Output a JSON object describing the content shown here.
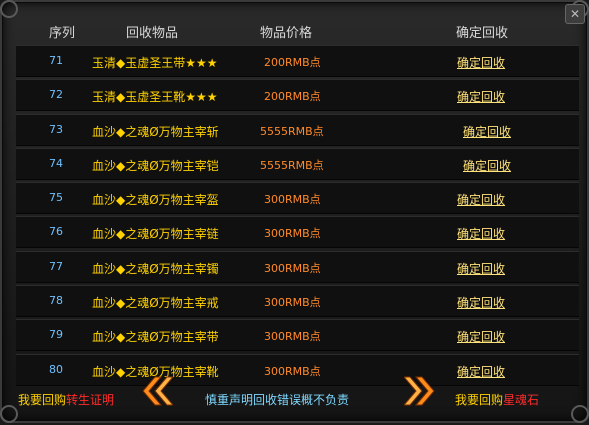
{
  "header": {
    "col_no": "序列",
    "col_item": "回收物品",
    "col_price": "物品价格",
    "col_action": "确定回收"
  },
  "rows": [
    {
      "no": "71",
      "item": "玉清◆玉虚圣王带★★★",
      "price": "200RMB点",
      "action": "确定回收"
    },
    {
      "no": "72",
      "item": "玉清◆玉虚圣王靴★★★",
      "price": "200RMB点",
      "action": "确定回收"
    },
    {
      "no": "73",
      "item": "血沙◆之魂Ø万物主宰斩",
      "price": "5555RMB点",
      "action": "确定回收"
    },
    {
      "no": "74",
      "item": "血沙◆之魂Ø万物主宰铠",
      "price": "5555RMB点",
      "action": "确定回收"
    },
    {
      "no": "75",
      "item": "血沙◆之魂Ø万物主宰盔",
      "price": "300RMB点",
      "action": "确定回收"
    },
    {
      "no": "76",
      "item": "血沙◆之魂Ø万物主宰链",
      "price": "300RMB点",
      "action": "确定回收"
    },
    {
      "no": "77",
      "item": "血沙◆之魂Ø万物主宰镯",
      "price": "300RMB点",
      "action": "确定回收"
    },
    {
      "no": "78",
      "item": "血沙◆之魂Ø万物主宰戒",
      "price": "300RMB点",
      "action": "确定回收"
    },
    {
      "no": "79",
      "item": "血沙◆之魂Ø万物主宰带",
      "price": "300RMB点",
      "action": "确定回收"
    },
    {
      "no": "80",
      "item": "血沙◆之魂Ø万物主宰靴",
      "price": "300RMB点",
      "action": "确定回收"
    }
  ],
  "footer": {
    "left_prefix": "我要回购",
    "left_link": "转生证明",
    "notice": "慎重声明回收错误概不负责",
    "right_prefix": "我要回购",
    "right_link": "星魂石"
  },
  "colors": {
    "number": "#6ec1ff",
    "item": "#ffd200",
    "price": "#ff8a2a",
    "action": "#ffe27a",
    "link_red": "#ff2b2b",
    "notice": "#7fd8ff",
    "arrow": "#ff8c1a"
  },
  "icons": {
    "prev": "double-chevron-left-icon",
    "next": "double-chevron-right-icon",
    "close": "close-icon"
  }
}
